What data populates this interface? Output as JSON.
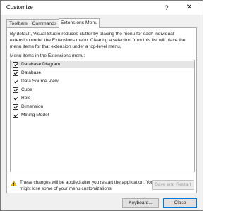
{
  "window": {
    "title": "Customize"
  },
  "titlebar": {
    "help_glyph": "?",
    "close_glyph": "✕"
  },
  "tabs": [
    {
      "label": "Toolbars"
    },
    {
      "label": "Commands"
    },
    {
      "label": "Extensions Menu"
    }
  ],
  "panel": {
    "description": "By default, Visual Studio reduces clutter by placing the menu for each individual extension under the Extensions menu. Clearing a selection from this list will place the menu items for that extension under a top-level menu.",
    "list_label": "Menu items in the Extensions menu:",
    "items": [
      {
        "label": "Database Diagram",
        "checked": true,
        "selected": true
      },
      {
        "label": "Database",
        "checked": true
      },
      {
        "label": "Data Source View",
        "checked": true
      },
      {
        "label": "Cube",
        "checked": true
      },
      {
        "label": "Role",
        "checked": true
      },
      {
        "label": "Dimension",
        "checked": true
      },
      {
        "label": "Mining Model",
        "checked": true
      }
    ],
    "warning": "These changes will be applied after you restart the application. You might lose some of your menu customizations.",
    "save_restart_label": "Save and Restart"
  },
  "footer": {
    "keyboard_label": "Keyboard...",
    "close_label": "Close"
  },
  "colors": {
    "accent": "#0078d7",
    "warning_icon": "#f2c811"
  }
}
